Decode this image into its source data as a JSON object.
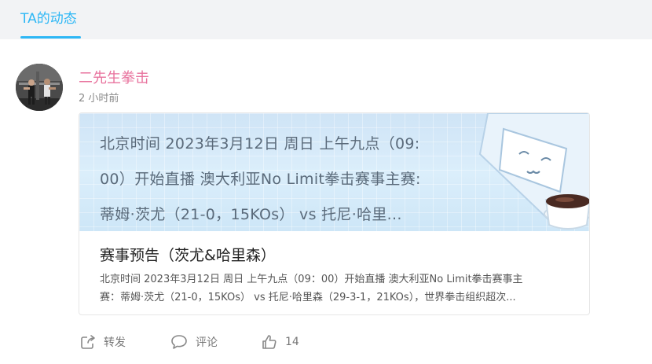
{
  "tabs": {
    "active_label": "TA的动态"
  },
  "post": {
    "author": "二先生拳击",
    "time": "2 小时前",
    "banner_lines": [
      "北京时间 2023年3月12日 周日 上午九点（09:",
      "00）开始直播 澳大利亚No Limit拳击赛事主赛:",
      "蒂姆·茨尤（21-0，15KOs） vs 托尼·哈里..."
    ],
    "card_title": "赛事预告（茨尤&哈里森）",
    "card_desc_lines": [
      "北京时间 2023年3月12日 周日 上午九点（09：00）开始直播 澳大利亚No Limit拳击赛事主",
      "赛：蒂姆·茨尤（21-0，15KOs） vs 托尼·哈里森（29-3-1，21KOs），世界拳击组织超次..."
    ]
  },
  "actions": {
    "share_label": "转发",
    "comment_label": "评论",
    "like_count": "14"
  },
  "colors": {
    "accent": "#2db7f5",
    "author": "#e8739e",
    "tab_bg": "#f2f3f5"
  },
  "icons": {
    "share": "share-icon",
    "comment": "comment-icon",
    "like": "thumbs-up-icon"
  }
}
